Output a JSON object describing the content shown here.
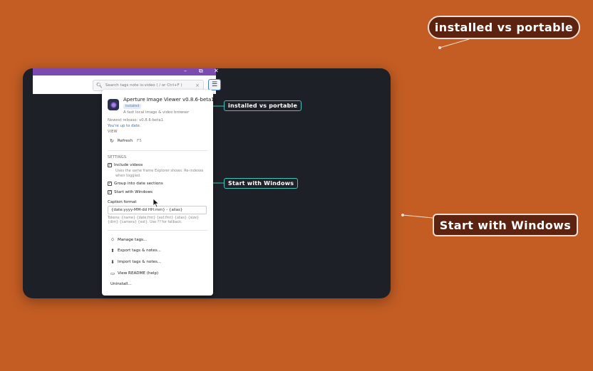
{
  "callouts": {
    "top": "installed vs portable",
    "right": "Start with Windows",
    "panel_top": "installed vs portable",
    "panel_mid": "Start with Windows"
  },
  "window": {
    "controls": [
      "–",
      "⧉",
      "✕"
    ]
  },
  "search": {
    "placeholder": "Search  tags  note  is:video   ( / or Ctrl+F )"
  },
  "menu": {
    "app_name": "Aperture Image Viewer v0.8.6-beta1",
    "install_badge": "Installed",
    "description": "A fast local image & video browser",
    "newest_release": "Newest release: v0.8.6-beta1",
    "up_to_date": "You're up to date.",
    "view_heading": "VIEW",
    "refresh_label": "Refresh",
    "refresh_key": "F5",
    "settings_heading": "SETTINGS",
    "include_videos": "Include videos",
    "include_videos_note": "Uses the same frame Explorer shows. Re-indexes when toggled.",
    "group_by_date": "Group into date sections",
    "start_with_windows": "Start with Windows",
    "caption_label": "Caption format",
    "caption_value": "{date:yyyy-MM-dd HH:mm} - {alias}",
    "tokens_note": "Tokens: {name} {date:fmt} {ext:fmt} {alias} {size} {dim} {camera} {ext}. Use ?? for fallback.",
    "actions": {
      "manage_tags": "Manage tags...",
      "export": "Export tags & notes...",
      "import": "Import tags & notes...",
      "readme": "View README (help)",
      "uninstall": "Uninstall..."
    }
  },
  "icons": {
    "menu": "hamburger-icon",
    "search": "search-icon",
    "clear": "close-icon",
    "refresh": "refresh-icon",
    "tag": "tag-icon",
    "export": "export-icon",
    "import": "import-icon",
    "readme": "help-icon",
    "cursor": "mouse-cursor-icon"
  },
  "colors": {
    "background": "#c45d24",
    "window": "#1d2027",
    "titlebar": "#7d4bb0",
    "callout_fill": "#5c2410",
    "small_callout_border": "#3ec4b8",
    "link": "#2f6fcf"
  }
}
